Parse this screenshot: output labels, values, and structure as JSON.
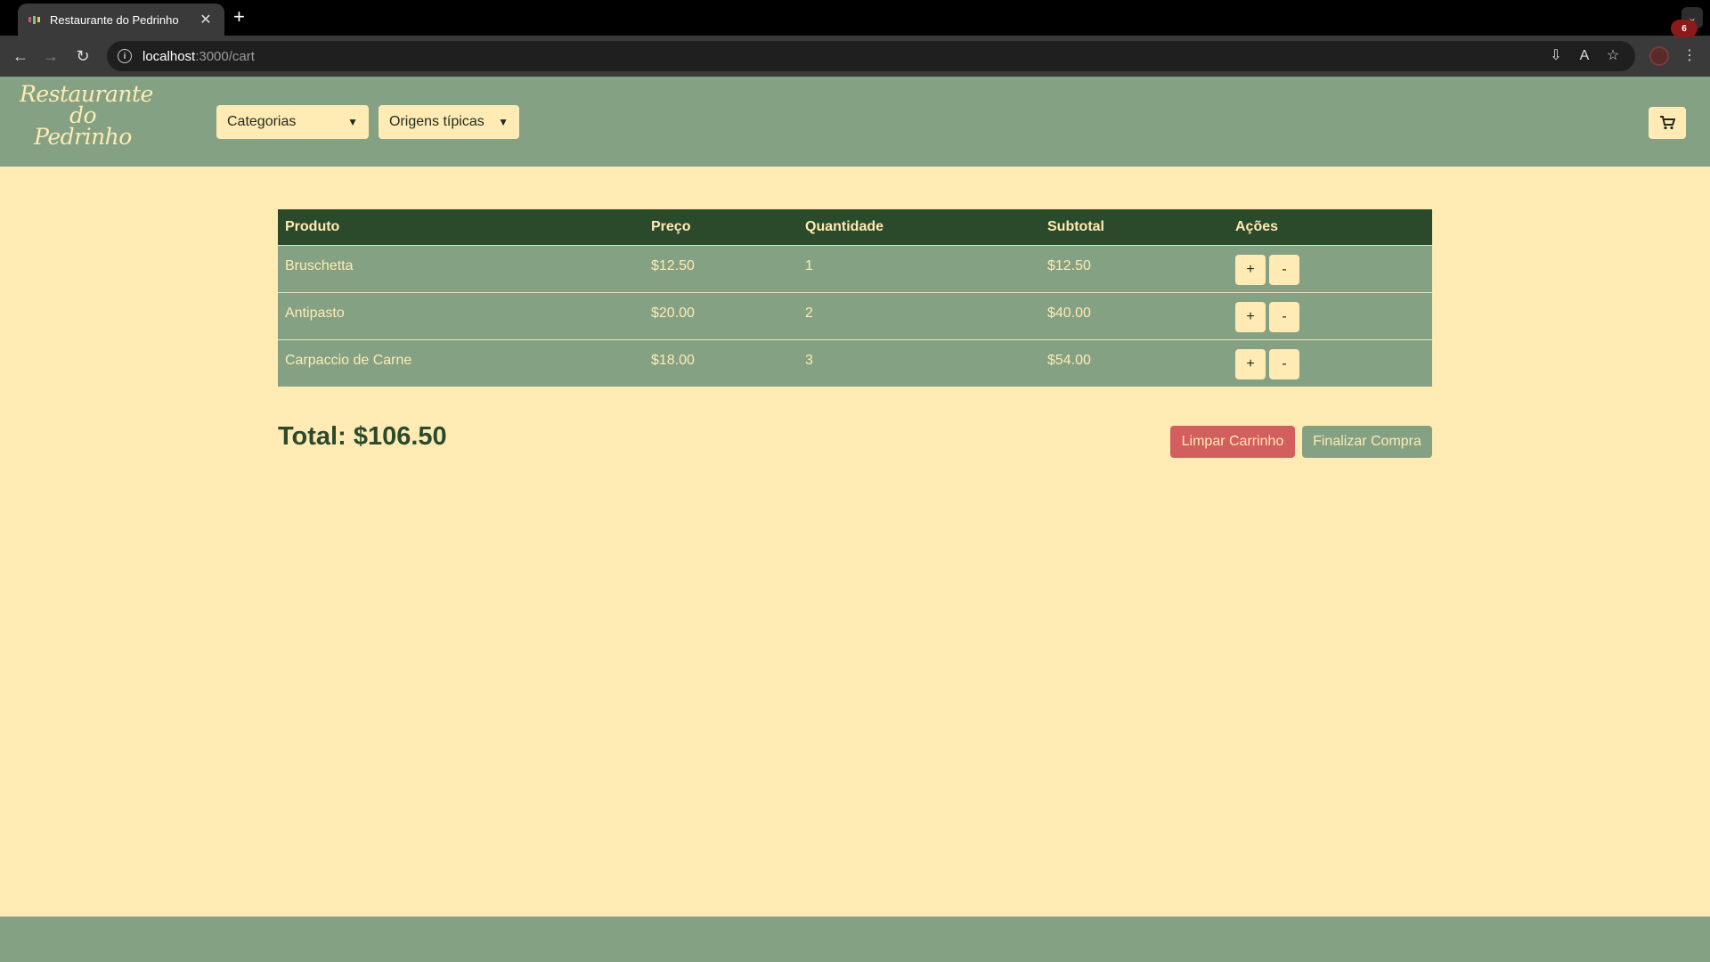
{
  "browser": {
    "tab_title": "Restaurante do Pedrinho",
    "tab_close": "✕",
    "new_tab": "+",
    "url_host": "localhost",
    "url_path": ":3000/cart"
  },
  "header": {
    "logo_line1": "Restaurante",
    "logo_line2": "do",
    "logo_line3": "Pedrinho",
    "categories_label": "Categorias",
    "origins_label": "Origens típicas",
    "cart_count": "6"
  },
  "cart": {
    "columns": [
      "Produto",
      "Preço",
      "Quantidade",
      "Subtotal",
      "Ações"
    ],
    "rows": [
      {
        "product": "Bruschetta",
        "price": "$12.50",
        "quantity": "1",
        "subtotal": "$12.50"
      },
      {
        "product": "Antipasto",
        "price": "$20.00",
        "quantity": "2",
        "subtotal": "$40.00"
      },
      {
        "product": "Carpaccio de Carne",
        "price": "$18.00",
        "quantity": "3",
        "subtotal": "$54.00"
      }
    ],
    "plus_label": "+",
    "minus_label": "-",
    "total_label": "Total: $106.50",
    "clear_label": "Limpar Carrinho",
    "finish_label": "Finalizar Compra"
  },
  "colors": {
    "page_bg": "#ffebb3",
    "header_bg": "#84a184",
    "table_header_bg": "#2b4a2b",
    "danger": "#d25e5e",
    "badge": "#8b1a1a"
  }
}
